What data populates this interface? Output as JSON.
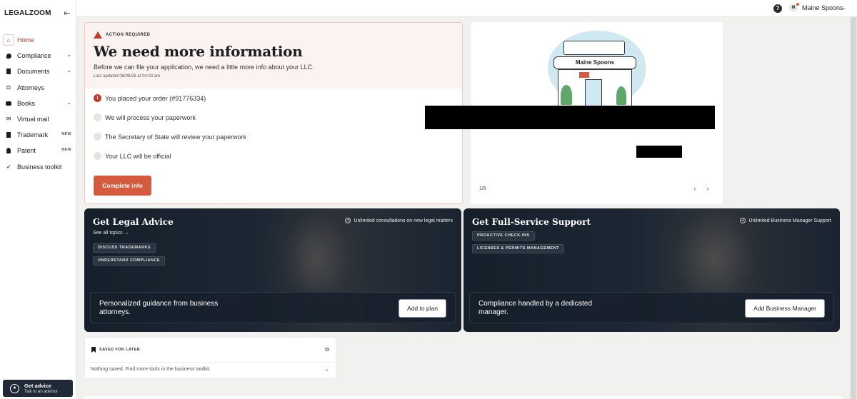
{
  "brand": {
    "logo_text": "LEGALZOOM"
  },
  "sidebar": {
    "collapse_icon": "collapse-sidebar-icon",
    "items": [
      {
        "label": "Home",
        "icon": "home-icon",
        "active": true
      },
      {
        "label": "Compliance",
        "icon": "compliance-icon",
        "chevron": true
      },
      {
        "label": "Documents",
        "icon": "documents-icon",
        "chevron": true
      },
      {
        "label": "Attorneys",
        "icon": "attorneys-icon"
      },
      {
        "label": "Books",
        "icon": "books-icon",
        "chevron": true
      },
      {
        "label": "Virtual mail",
        "icon": "mail-icon"
      },
      {
        "label": "Trademark",
        "icon": "trademark-icon",
        "badge": "NEW"
      },
      {
        "label": "Patent",
        "icon": "patent-icon",
        "badge": "NEW"
      },
      {
        "label": "Business toolkit",
        "icon": "rocket-icon"
      }
    ],
    "advisor": {
      "title": "Get advice",
      "subtitle": "Talk to an advisor"
    }
  },
  "topbar": {
    "help_icon": "help-icon",
    "avatar_initial": "M",
    "user_name": "Maine Spoons"
  },
  "action_card": {
    "label": "ACTION REQUIRED",
    "title": "We need more information",
    "description": "Before we can file your application, we need a little more info about your LLC.",
    "updated": "Last updated 06/08/26 at 04:03 am",
    "steps": [
      {
        "num": "1",
        "text": "You placed your order (#91776334)"
      },
      {
        "num": "",
        "text": "We will process your paperwork"
      },
      {
        "num": "",
        "text": "The Secretary of State will review your paperwork"
      },
      {
        "num": "",
        "text": "Your LLC will be official"
      }
    ],
    "button": "Complete info"
  },
  "carousel": {
    "store_sign": "Maine Spoons",
    "pager": "1/5",
    "prev_icon": "chevron-left-icon",
    "next_icon": "chevron-right-icon"
  },
  "legal_card": {
    "title": "Get Legal Advice",
    "see_all": "See all topics",
    "see_all_arrow": "→",
    "perk": "Unlimited consultations on new legal matters",
    "pills": [
      "DISCUSS TRADEMARKS",
      "UNDERSTAND COMPLIANCE"
    ],
    "tagline": "Personalized guidance from business attorneys.",
    "cta": "Add to plan"
  },
  "support_card": {
    "title": "Get Full-Service Support",
    "perk": "Unlimited Business Manager Support",
    "pills": [
      "PROACTIVE CHECK-INS",
      "LICENSES & PERMITS MANAGEMENT"
    ],
    "tagline": "Compliance handled by a dedicated manager.",
    "cta": "Add Business Manager"
  },
  "saved_card": {
    "label": "SAVED FOR LATER",
    "empty_text": "Nothing saved. Find more tools in the business toolkit."
  },
  "colors": {
    "accent": "#d65a3d",
    "alert_red": "#c0392b",
    "dark_card": "#1d2733"
  }
}
